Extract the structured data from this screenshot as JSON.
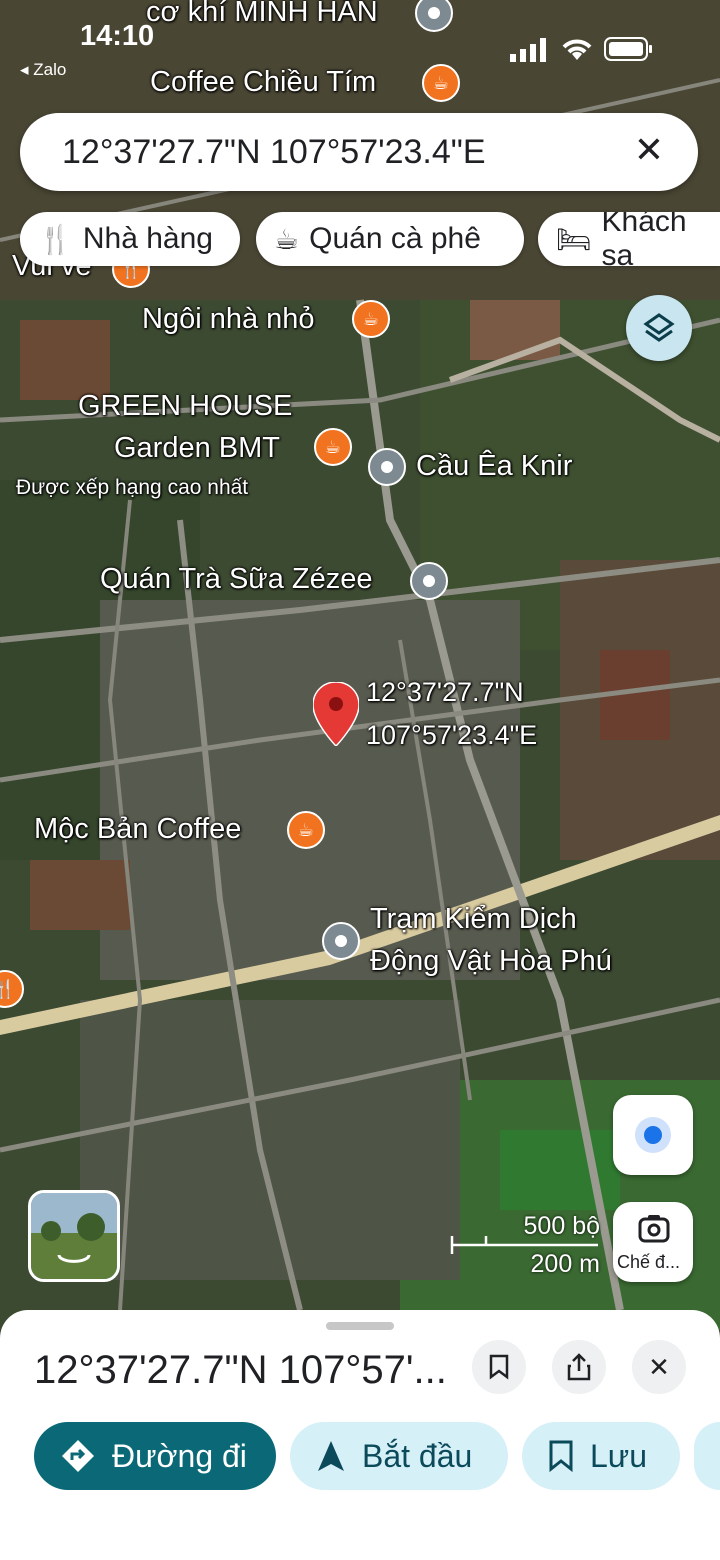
{
  "status_bar": {
    "time": "14:10",
    "back_app": "◂ Zalo"
  },
  "search": {
    "query": "12°37'27.7\"N 107°57'23.4\"E"
  },
  "chips": [
    {
      "icon": "restaurant-icon",
      "label": "Nhà hàng"
    },
    {
      "icon": "coffee-icon",
      "label": "Quán cà phê"
    },
    {
      "icon": "hotel-icon",
      "label": "Khách sạ"
    }
  ],
  "map_labels": {
    "top_cut": "cơ khí MINH HÂN",
    "coffee_chieu_tim": "Coffee Chiều Tím",
    "vui_ve": "Vui vẻ",
    "ngoi_nha_nho": "Ngôi nhà nhỏ",
    "green_house_1": "GREEN HOUSE",
    "green_house_2": "Garden BMT",
    "green_house_sub": "Được xếp hạng cao nhất",
    "cau_ea_knir": "Cầu Êa Knir",
    "tra_sua": "Quán Trà Sữa Zézee",
    "pin_lat": "12°37'27.7\"N",
    "pin_lng": "107°57'23.4\"E",
    "moc_ban": "Mộc Bản Coffee",
    "tram_1": "Trạm Kiểm Dịch",
    "tram_2": "Động Vật Hòa Phú"
  },
  "scale": {
    "imperial": "500 bộ",
    "metric": "200 m"
  },
  "lens_label": "Chế đ...",
  "sheet": {
    "title": "12°37'27.7\"N 107°57'...",
    "buttons": [
      {
        "icon": "directions-icon",
        "label": "Đường đi"
      },
      {
        "icon": "navigation-arrow-icon",
        "label": "Bắt đầu"
      },
      {
        "icon": "bookmark-icon",
        "label": "Lưu"
      }
    ]
  }
}
